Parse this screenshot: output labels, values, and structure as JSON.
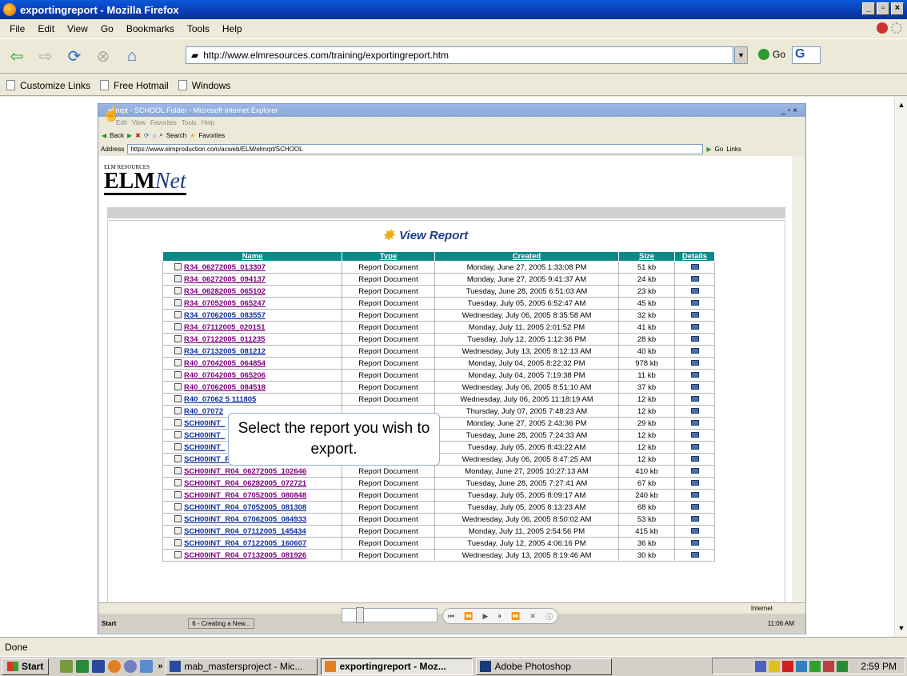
{
  "firefox": {
    "title": "exportingreport - Mozilla Firefox",
    "menu": [
      "File",
      "Edit",
      "View",
      "Go",
      "Bookmarks",
      "Tools",
      "Help"
    ],
    "url": "http://www.elmresources.com/training/exportingreport.htm",
    "go_label": "Go",
    "bookmarks": [
      "Customize Links",
      "Free Hotmail",
      "Windows"
    ],
    "status": "Done"
  },
  "ie": {
    "title": "elmrpt - SCHOOL Folder - Microsoft Internet Explorer",
    "menu": [
      "Edit",
      "View",
      "Favorites",
      "Tools",
      "Help"
    ],
    "toolbar": {
      "back": "Back",
      "search": "Search",
      "favorites": "Favorites"
    },
    "address_label": "Address",
    "address": "https://www.elmproduction.com/acweb/ELM/elmrpt/SCHOOL",
    "go_label": "Go",
    "links_label": "Links",
    "status_zone": "Internet",
    "taskbar": {
      "start": "Start",
      "task": "6 - Creating a New...",
      "clock": "11:06 AM"
    }
  },
  "page": {
    "logo_small": "ELM RESOURCES",
    "logo_main": "ELM",
    "logo_net": "Net",
    "heading": "View Report",
    "columns": [
      "Name",
      "Type",
      "Created",
      "Size",
      "Details"
    ],
    "rows": [
      {
        "name": "R34_06272005_013307",
        "type": "Report Document",
        "created": "Monday, June 27, 2005 1:33:08 PM",
        "size": "51 kb",
        "visited": true
      },
      {
        "name": "R34_06272005_094137",
        "type": "Report Document",
        "created": "Monday, June 27, 2005 9:41:37 AM",
        "size": "24 kb",
        "visited": true
      },
      {
        "name": "R34_06282005_065102",
        "type": "Report Document",
        "created": "Tuesday, June 28, 2005 6:51:03 AM",
        "size": "23 kb",
        "visited": true
      },
      {
        "name": "R34_07052005_065247",
        "type": "Report Document",
        "created": "Tuesday, July 05, 2005 6:52:47 AM",
        "size": "45 kb",
        "visited": true
      },
      {
        "name": "R34_07062005_083557",
        "type": "Report Document",
        "created": "Wednesday, July 06, 2005 8:35:58 AM",
        "size": "32 kb",
        "visited": false
      },
      {
        "name": "R34_07112005_020151",
        "type": "Report Document",
        "created": "Monday, July 11, 2005 2:01:52 PM",
        "size": "41 kb",
        "visited": true
      },
      {
        "name": "R34_07122005_011235",
        "type": "Report Document",
        "created": "Tuesday, July 12, 2005 1:12:36 PM",
        "size": "28 kb",
        "visited": true
      },
      {
        "name": "R34_07132005_081212",
        "type": "Report Document",
        "created": "Wednesday, July 13, 2005 8:12:13 AM",
        "size": "40 kb",
        "visited": false
      },
      {
        "name": "R40_07042005_064854",
        "type": "Report Document",
        "created": "Monday, July 04, 2005 8:22:32 PM",
        "size": "978 kb",
        "visited": true
      },
      {
        "name": "R40_07042005_065206",
        "type": "Report Document",
        "created": "Monday, July 04, 2005 7:19:38 PM",
        "size": "11 kb",
        "visited": true
      },
      {
        "name": "R40_07062005_084518",
        "type": "Report Document",
        "created": "Wednesday, July 06, 2005 8:51:10 AM",
        "size": "37 kb",
        "visited": true
      },
      {
        "name": "R40_07062 5 111805",
        "type": "Report Document",
        "created": "Wednesday, July 06, 2005 11:18:19 AM",
        "size": "12 kb",
        "visited": false
      },
      {
        "name": "R40_07072",
        "type": "",
        "created": "Thursday, July 07, 2005 7:48:23 AM",
        "size": "12 kb",
        "visited": false
      },
      {
        "name": "SCH00INT_",
        "type": "",
        "created": "Monday, June 27, 2005 2:43:36 PM",
        "size": "29 kb",
        "visited": false
      },
      {
        "name": "SCH00INT_",
        "type": "",
        "created": "Tuesday, June 28, 2005 7:24:33 AM",
        "size": "12 kb",
        "visited": false
      },
      {
        "name": "SCH00INT_",
        "type": "",
        "created": "Tuesday, July 05, 2005 8:43:22 AM",
        "size": "12 kb",
        "visited": false
      },
      {
        "name": "SCH00INT_R02_07062005_084705",
        "type": "Report Document",
        "created": "Wednesday, July 06, 2005 8:47:25 AM",
        "size": "12 kb",
        "visited": false
      },
      {
        "name": "SCH00INT_R04_06272005_102646",
        "type": "Report Document",
        "created": "Monday, June 27, 2005 10:27:13 AM",
        "size": "410 kb",
        "visited": true
      },
      {
        "name": "SCH00INT_R04_06282005_072721",
        "type": "Report Document",
        "created": "Tuesday, June 28, 2005 7:27:41 AM",
        "size": "67 kb",
        "visited": true
      },
      {
        "name": "SCH00INT_R04_07052005_080848",
        "type": "Report Document",
        "created": "Tuesday, July 05, 2005 8:09:17 AM",
        "size": "240 kb",
        "visited": true
      },
      {
        "name": "SCH00INT_R04_07052005_081308",
        "type": "Report Document",
        "created": "Tuesday, July 05, 2005 8:13:23 AM",
        "size": "68 kb",
        "visited": false
      },
      {
        "name": "SCH00INT_R04_07062005_084933",
        "type": "Report Document",
        "created": "Wednesday, July 06, 2005 8:50:02 AM",
        "size": "53 kb",
        "visited": false
      },
      {
        "name": "SCH00INT_R04_07112005_145434",
        "type": "Report Document",
        "created": "Monday, July 11, 2005 2:54:56 PM",
        "size": "415 kb",
        "visited": false
      },
      {
        "name": "SCH00INT_R04_07122005_160607",
        "type": "Report Document",
        "created": "Tuesday, July 12, 2005 4:06:16 PM",
        "size": "36 kb",
        "visited": false
      },
      {
        "name": "SCH00INT_R04_07132005_081926",
        "type": "Report Document",
        "created": "Wednesday, July 13, 2005 8:19:46 AM",
        "size": "30 kb",
        "visited": true
      }
    ],
    "callout": "Select the report you wish to export."
  },
  "taskbar": {
    "start": "Start",
    "tasks": [
      {
        "label": "mab_mastersproject - Mic...",
        "active": false
      },
      {
        "label": "exportingreport - Moz...",
        "active": true
      },
      {
        "label": "Adobe Photoshop",
        "active": false
      }
    ],
    "clock": "2:59 PM"
  },
  "colors": {
    "visited_link": "#800080",
    "unvisited_link": "#1030a0",
    "table_header": "#0b8a8a",
    "title_bar": "#0a3cb6"
  }
}
